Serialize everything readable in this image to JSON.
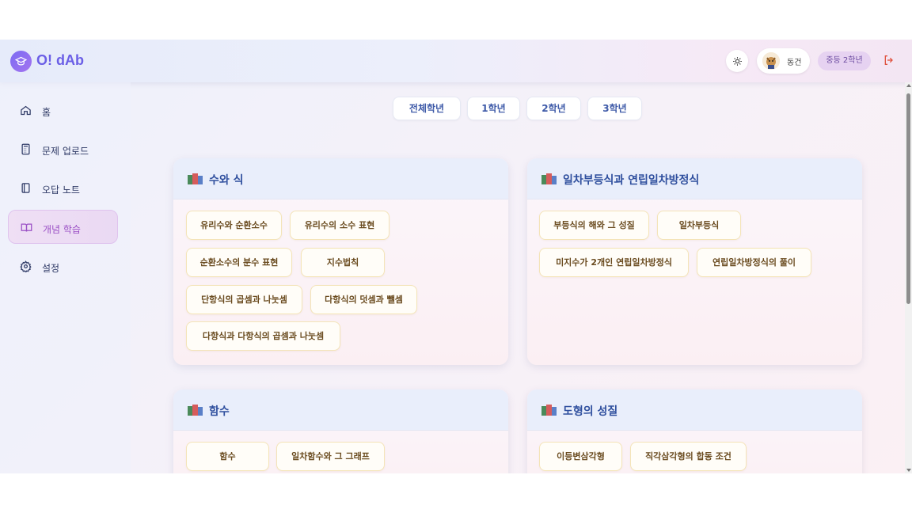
{
  "app": {
    "title": "O! dAb"
  },
  "header": {
    "theme_icon": "sun-icon",
    "user_name": "동건",
    "grade_badge": "중등 2학년",
    "logout_icon": "logout-icon"
  },
  "sidebar": {
    "items": [
      {
        "label": "홈",
        "icon": "home-icon",
        "active": false
      },
      {
        "label": "문제 업로드",
        "icon": "calculator-icon",
        "active": false
      },
      {
        "label": "오답 노트",
        "icon": "notebook-icon",
        "active": false
      },
      {
        "label": "개념 학습",
        "icon": "open-book-icon",
        "active": true
      },
      {
        "label": "설정",
        "icon": "gear-icon",
        "active": false
      }
    ]
  },
  "grade_tabs": [
    "전체학년",
    "1학년",
    "2학년",
    "3학년"
  ],
  "cards": [
    {
      "title": "수와 식",
      "topics": [
        "유리수와 순환소수",
        "유리수의 소수 표현",
        "순환소수의 분수 표현",
        "지수법칙",
        "단항식의 곱셈과 나눗셈",
        "다항식의 덧셈과 뺄셈",
        "다항식과 다항식의 곱셈과 나눗셈"
      ]
    },
    {
      "title": "일차부등식과 연립일차방정식",
      "topics": [
        "부등식의 해와 그 성질",
        "일차부등식",
        "미지수가 2개인 연립일차방정식",
        "연립일차방정식의 풀이"
      ]
    },
    {
      "title": "함수",
      "topics": [
        "함수",
        "일차함수와 그 그래프"
      ]
    },
    {
      "title": "도형의 성질",
      "topics": [
        "이등변삼각형",
        "직각삼각형의 합동 조건"
      ]
    }
  ],
  "colors": {
    "accent": "#6b5fe6",
    "active_nav": "#9a4fc5",
    "card_title": "#2f4f9e",
    "chip_text": "#6a4b1f"
  }
}
